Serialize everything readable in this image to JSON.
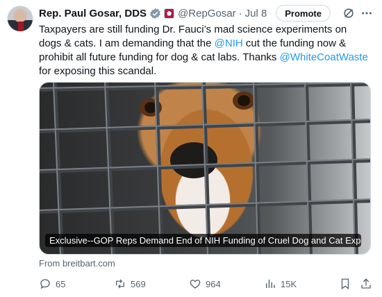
{
  "tweet": {
    "author_name": "Rep. Paul Gosar, DDS",
    "handle": "@RepGosar",
    "separator": "·",
    "time": "Jul 8",
    "promote_label": "Promote",
    "text_1": "Taxpayers are still funding Dr. Fauci’s mad science experiments on dogs & cats.  I am demanding that the ",
    "mention_nih": "@NIH",
    "text_2": " cut the funding now & prohibit all future funding for dog & cat labs. Thanks ",
    "mention_wcw": "@WhiteCoatWaste",
    "text_3": " for exposing this scandal.",
    "link_card": {
      "caption": "Exclusive--GOP Reps Demand End of NIH Funding of Cruel Dog and Cat Experi...",
      "source": "From breitbart.com"
    },
    "stats": {
      "replies": "65",
      "reposts": "569",
      "likes": "964",
      "views": "15K"
    }
  },
  "colors": {
    "link": "#1d9bf0",
    "muted": "#536471",
    "text": "#0f1419",
    "verified": "#829aab"
  },
  "icons": {
    "verified": "verified-badge-icon",
    "affiliation": "congress-affiliation-icon",
    "grok": "grok-icon",
    "more": "more-icon",
    "reply": "reply-icon",
    "repost": "repost-icon",
    "like": "heart-icon",
    "views": "views-icon",
    "bookmark": "bookmark-icon",
    "share": "share-icon"
  }
}
